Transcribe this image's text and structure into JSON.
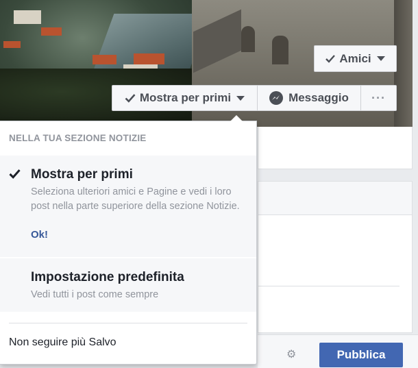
{
  "profile_actions": {
    "friends_label": "Amici",
    "see_first_label": "Mostra per primi",
    "message_label": "Messaggio",
    "more_label": "···"
  },
  "dropdown": {
    "header": "NELLA TUA SEZIONE NOTIZIE",
    "options": [
      {
        "title": "Mostra per primi",
        "description": "Seleziona ulteriori amici e Pagine e vedi i loro post nella parte superiore della sezione Notizie.",
        "link": "Ok!",
        "selected": true
      },
      {
        "title": "Impostazione predefinita",
        "description": "Vedi tutti i post come sempre",
        "selected": false
      }
    ],
    "unfollow_label": "Non seguire più Salvo"
  },
  "composer": {
    "publish_label": "Pubblica"
  },
  "colors": {
    "accent": "#4267b2",
    "link": "#365899"
  }
}
